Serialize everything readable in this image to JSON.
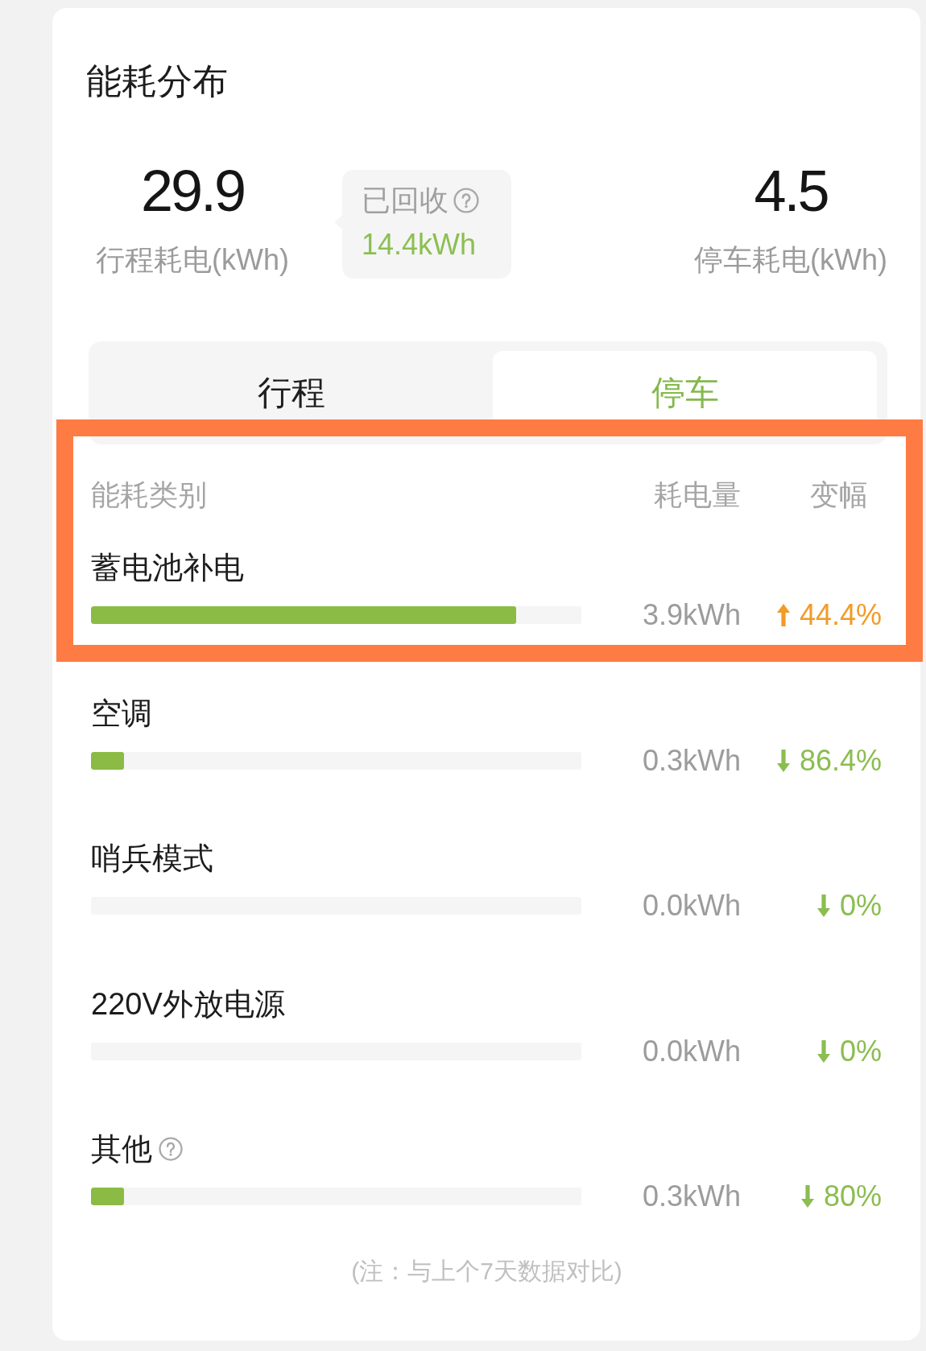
{
  "title": "能耗分布",
  "summary": {
    "trip": {
      "value": "29.9",
      "label": "行程耗电(kWh)"
    },
    "recovered": {
      "label": "已回收",
      "help": true,
      "value": "14.4kWh"
    },
    "parking": {
      "value": "4.5",
      "label": "停车耗电(kWh)"
    }
  },
  "tabs": [
    {
      "label": "行程",
      "selected": false
    },
    {
      "label": "停车",
      "selected": true
    }
  ],
  "table": {
    "columns": [
      "能耗类别",
      "耗电量",
      "变幅"
    ],
    "rows": [
      {
        "name": "蓄电池补电",
        "help": false,
        "level": 0.867,
        "energy": "3.9kWh",
        "rising": true,
        "change": "44.4%",
        "highlighted": true
      },
      {
        "name": "空调",
        "help": false,
        "level": 0.067,
        "energy": "0.3kWh",
        "rising": false,
        "change": "86.4%",
        "highlighted": false
      },
      {
        "name": "哨兵模式",
        "help": false,
        "level": 0,
        "energy": "0.0kWh",
        "rising": false,
        "change": "0%",
        "highlighted": false
      },
      {
        "name": "220V外放电源",
        "help": false,
        "level": 0,
        "energy": "0.0kWh",
        "rising": false,
        "change": "0%",
        "highlighted": false
      },
      {
        "name": "其他",
        "help": true,
        "level": 0.067,
        "energy": "0.3kWh",
        "rising": false,
        "change": "80%",
        "highlighted": false
      }
    ]
  },
  "note": "(注：与上个7天数据对比)"
}
